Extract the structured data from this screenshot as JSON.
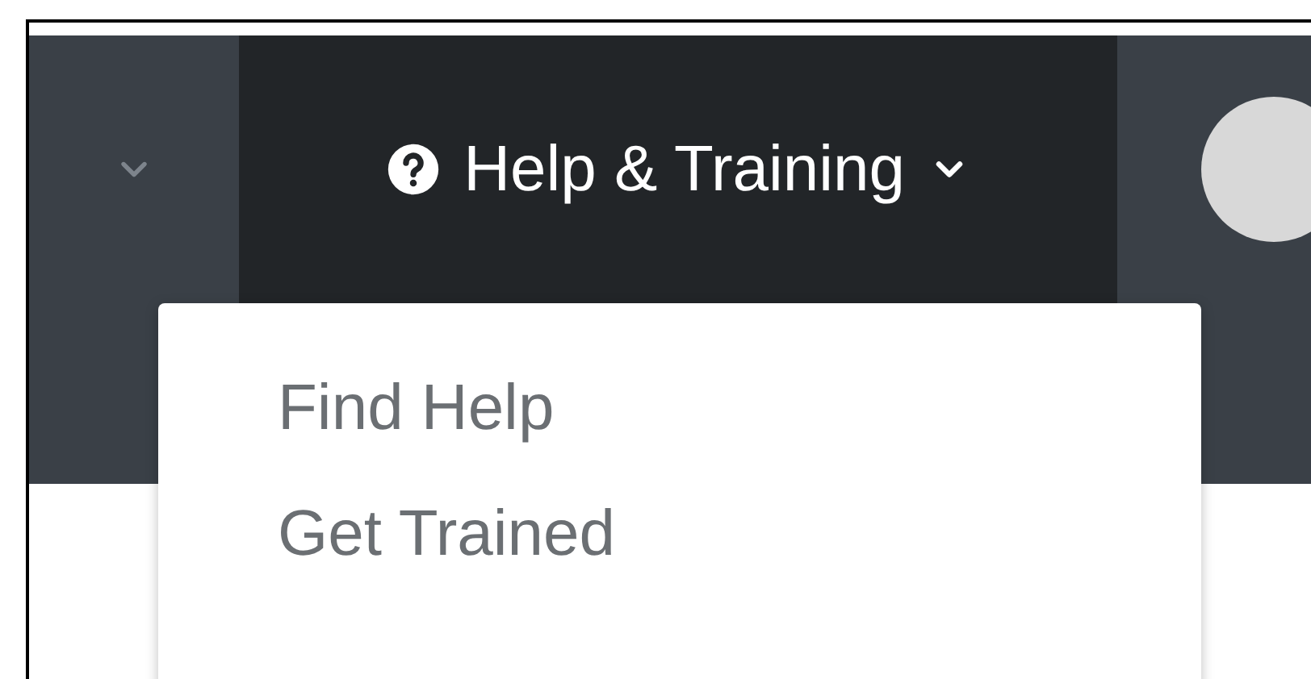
{
  "navbar": {
    "menu": {
      "label": "Help & Training",
      "expanded": true
    }
  },
  "dropdown": {
    "items": [
      {
        "label": "Find Help"
      },
      {
        "label": "Get Trained"
      }
    ]
  }
}
